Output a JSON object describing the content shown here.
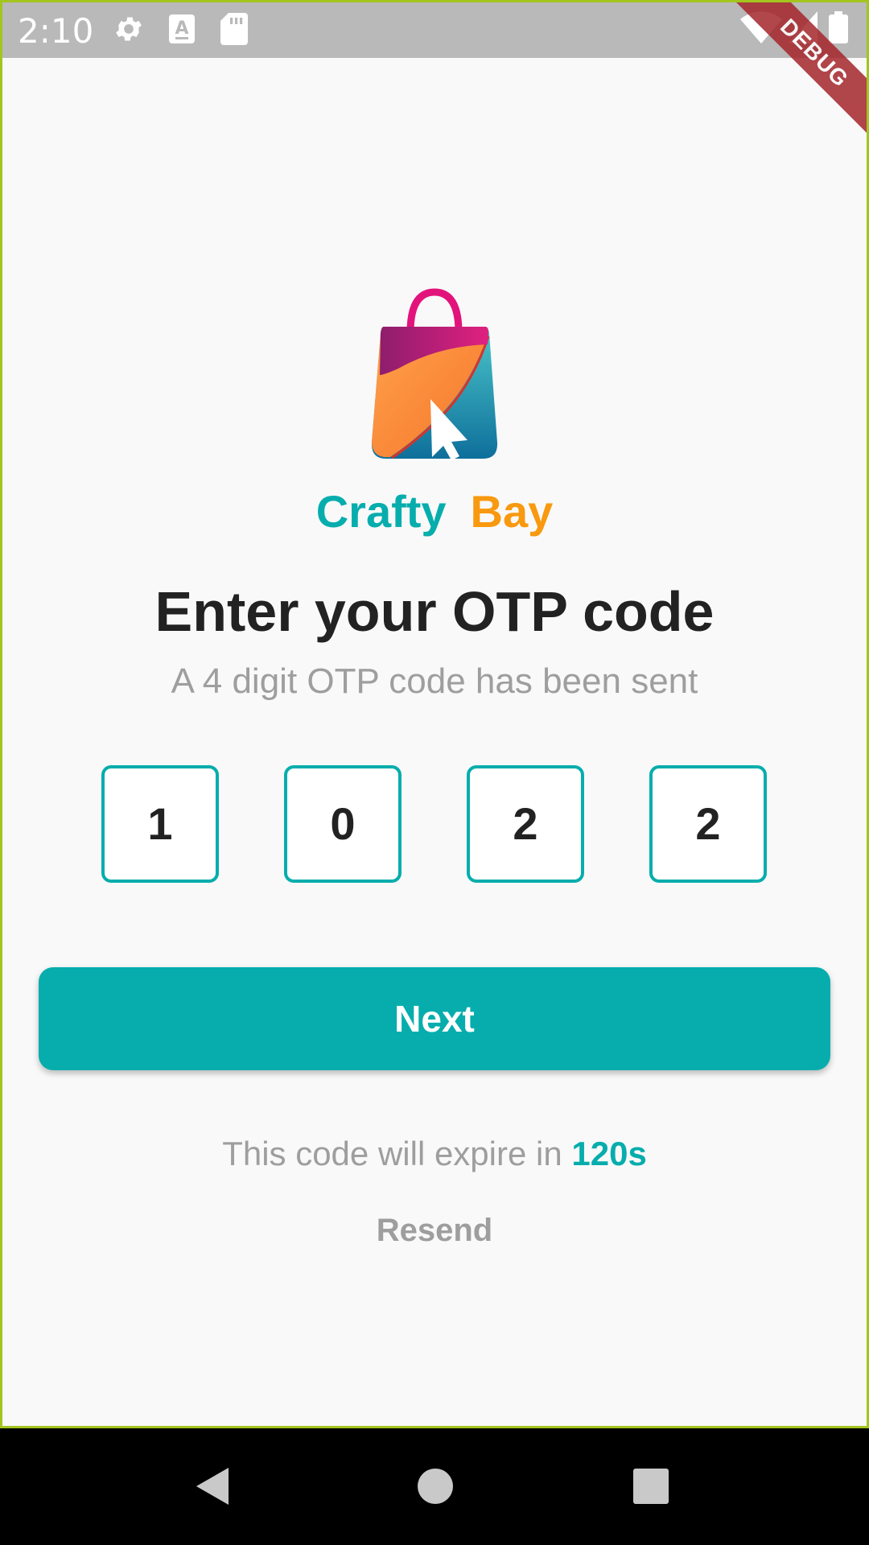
{
  "status_bar": {
    "time": "2:10",
    "icons": [
      "settings-icon",
      "keyboard-a-icon",
      "sd-card-icon",
      "wifi-icon",
      "signal-icon",
      "battery-icon"
    ]
  },
  "debug_banner": "DEBUG",
  "brand": {
    "part1": "Crafty",
    "part2": "Bay"
  },
  "screen": {
    "title": "Enter your OTP code",
    "subtitle": "A 4 digit OTP code has been sent"
  },
  "otp": {
    "digits": [
      "1",
      "0",
      "2",
      "2"
    ]
  },
  "next_button": {
    "label": "Next"
  },
  "expiry": {
    "text": "This code will expire in",
    "seconds": "120s"
  },
  "resend": {
    "label": "Resend"
  },
  "nav": {
    "icons": [
      "back-icon",
      "home-icon",
      "recents-icon"
    ]
  },
  "colors": {
    "primary": "#07adad",
    "accent": "#f8990f",
    "muted_text": "#9e9e9e",
    "debug_ribbon": "#a4262c"
  }
}
